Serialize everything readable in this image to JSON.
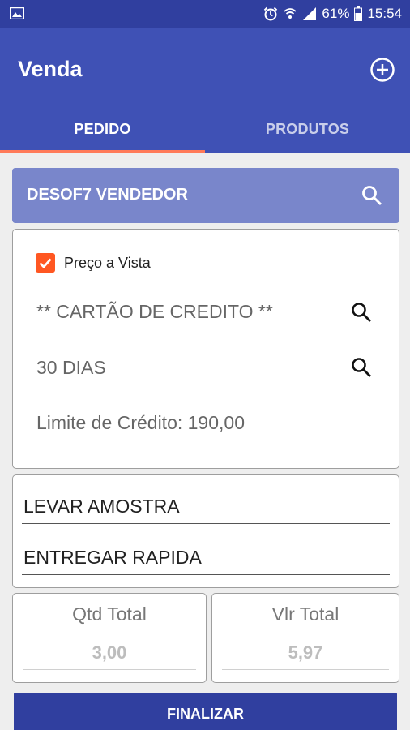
{
  "status_bar": {
    "battery": "61%",
    "time": "15:54",
    "icons": [
      "gallery-icon",
      "alarm-icon",
      "wifi-icon",
      "signal-icon",
      "battery-icon"
    ]
  },
  "app_bar": {
    "title": "Venda",
    "add_icon": "add-circle-icon"
  },
  "tabs": [
    {
      "label": "PEDIDO",
      "active": true
    },
    {
      "label": "PRODUTOS",
      "active": false
    }
  ],
  "vendor": {
    "label": "DESOF7 VENDEDOR",
    "icon": "search-icon"
  },
  "payment": {
    "checkbox_label": "Preço a Vista",
    "checked": true,
    "method": "** CARTÃO DE CREDITO **",
    "term": "30 DIAS",
    "credit_limit": "Limite de Crédito: 190,00"
  },
  "notes": {
    "line1": "LEVAR AMOSTRA",
    "line2": "ENTREGAR RAPIDA"
  },
  "totals": {
    "qtd_label": "Qtd Total",
    "qtd_value": "3,00",
    "vlr_label": "Vlr Total",
    "vlr_value": "5,97"
  },
  "actions": {
    "finalize_label": "FINALIZAR"
  },
  "colors": {
    "primary": "#3f51b5",
    "primary_dark": "#303f9f",
    "primary_light": "#7986cb",
    "accent": "#ff5722"
  }
}
